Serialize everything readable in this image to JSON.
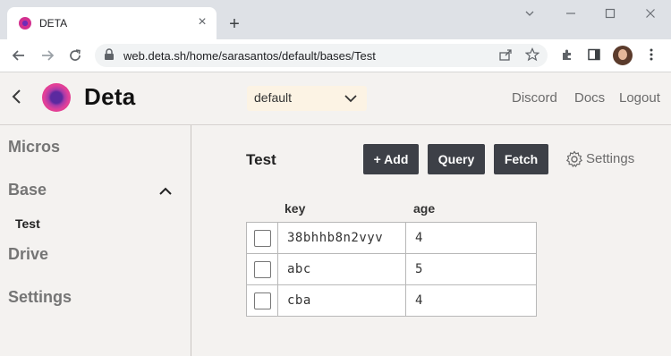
{
  "browser": {
    "tab": {
      "title": "DETA"
    },
    "address": {
      "url": "web.deta.sh/home/sarasantos/default/bases/Test"
    }
  },
  "app": {
    "brand": "Deta",
    "space_selector": {
      "value": "default"
    },
    "header_links": [
      "Discord",
      "Docs",
      "Logout"
    ],
    "sidebar": {
      "items": [
        {
          "label": "Micros"
        },
        {
          "label": "Base",
          "expanded": true,
          "children": [
            {
              "label": "Test"
            }
          ]
        },
        {
          "label": "Drive"
        },
        {
          "label": "Settings"
        }
      ]
    },
    "main": {
      "title": "Test",
      "buttons": {
        "add": "+ Add",
        "query": "Query",
        "fetch": "Fetch"
      },
      "settings_label": "Settings",
      "table": {
        "columns": [
          "key",
          "age"
        ],
        "rows": [
          {
            "key": "38bhhb8n2vyv",
            "age": "4"
          },
          {
            "key": "abc",
            "age": "5"
          },
          {
            "key": "cba",
            "age": "4"
          }
        ]
      }
    }
  },
  "colors": {
    "app_background": "#f4f2f0",
    "button_dark": "#3d4047",
    "select_background": "#fcf3e4",
    "brand_pink": "#e0409a",
    "brand_purple": "#5b2a9f"
  },
  "icons": [
    "favicon-icon",
    "close-icon",
    "plus-icon",
    "minimize-icon",
    "maximize-icon",
    "window-close-icon",
    "back-arrow-icon",
    "forward-arrow-icon",
    "reload-icon",
    "lock-icon",
    "share-icon",
    "star-icon",
    "extensions-icon",
    "sidepanel-icon",
    "avatar",
    "kebab-menu-icon",
    "chevron-left-icon",
    "deta-logo-icon",
    "chevron-down-icon",
    "chevron-up-icon",
    "gear-icon",
    "checkbox"
  ]
}
